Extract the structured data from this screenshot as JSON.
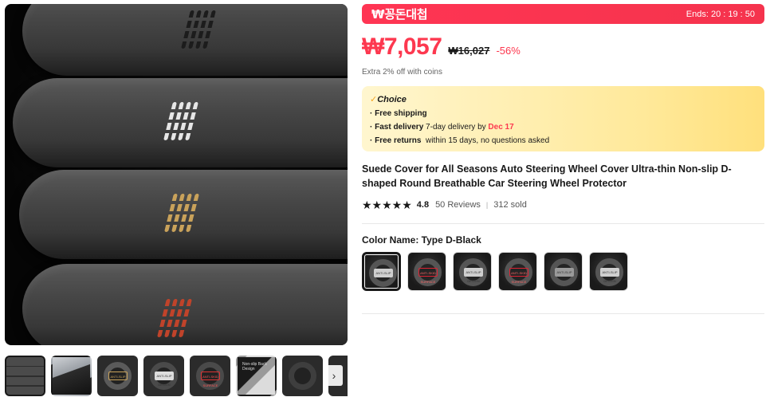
{
  "deal": {
    "title": "₩꽁돈대첩",
    "timer": "Ends: 20 : 19 : 50"
  },
  "price": {
    "current": "₩7,057",
    "original": "₩16,027",
    "discount": "-56%",
    "coins_note": "Extra 2% off with coins"
  },
  "choice": {
    "label": "Choice",
    "check": "✓",
    "free_shipping": "· Free shipping",
    "fast_delivery_label": "· Fast delivery",
    "fast_delivery_text": "7-day delivery by",
    "fast_delivery_date": "Dec 17",
    "free_returns_label": "· Free returns",
    "free_returns_text": "within 15 days, no questions asked"
  },
  "product": {
    "title": "Suede Cover for All Seasons Auto Steering Wheel Cover Ultra-thin Non-slip D-shaped Round Breathable Car Steering Wheel Protector",
    "rating_value": 4.8,
    "rating": "4.8",
    "stars": "★★★★★",
    "reviews": "50 Reviews",
    "sold": "312 sold",
    "separator": "|"
  },
  "color": {
    "label": "Color Name: Type D-Black",
    "selected_index": 0
  },
  "thumbnails": {
    "arrow": "›",
    "items": [
      {
        "name": "thumb-stacked-covers"
      },
      {
        "name": "thumb-car-interior"
      },
      {
        "name": "thumb-ring-gold"
      },
      {
        "name": "thumb-ring-white-tag"
      },
      {
        "name": "thumb-ring-red-tag"
      },
      {
        "name": "thumb-non-slip-design",
        "caption": "Non-slip Back Design"
      },
      {
        "name": "thumb-ring-dark"
      },
      {
        "name": "thumb-partial"
      }
    ]
  },
  "swatch_tags": {
    "white": "ANTI-SLIP DESIGN",
    "red": "ANTI-SKID SURFACE",
    "plain": "ANTI-SLIP"
  },
  "colors": {
    "accent": "#fd384f",
    "deal_bar": "#f5334d",
    "choice_bg": "#ffe99a"
  }
}
